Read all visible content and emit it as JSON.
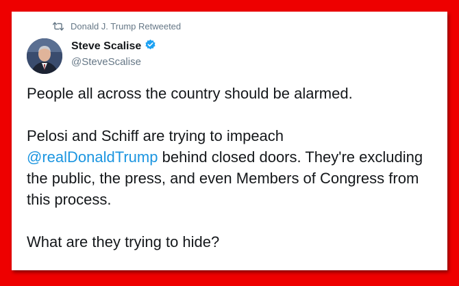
{
  "retweet": {
    "icon": "retweet-icon",
    "text": "Donald J. Trump Retweeted"
  },
  "author": {
    "avatar": "avatar-image",
    "display_name": "Steve Scalise",
    "verified_icon": "verified-badge-icon",
    "handle": "@SteveScalise"
  },
  "tweet": {
    "paragraph1": "People all across the country should be alarmed.",
    "paragraph2_before": "Pelosi and Schiff are trying to impeach",
    "mention": "@realDonaldTrump",
    "paragraph2_after": " behind closed doors. They're excluding the public, the press, and even Members of Congress from this process.",
    "paragraph3": "What are they trying to hide?"
  },
  "colors": {
    "frame": "#ee0000",
    "mention": "#1b95e0",
    "verified": "#1da1f2",
    "secondary_text": "#657786"
  }
}
